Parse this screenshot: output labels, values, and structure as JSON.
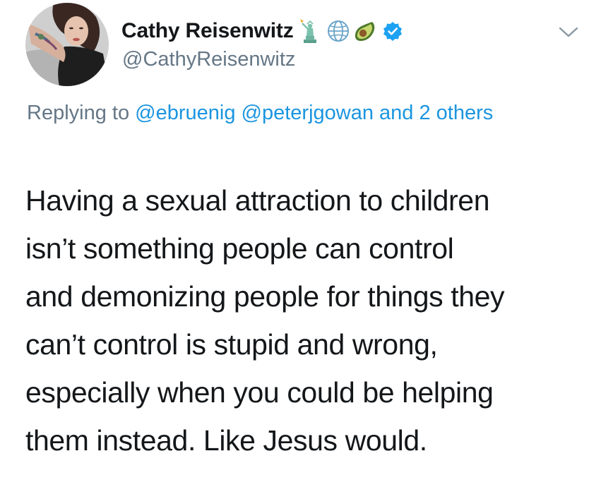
{
  "author": {
    "display_name": "Cathy Reisenwitz",
    "handle": "@CathyReisenwitz",
    "name_emojis": [
      "statue-of-liberty-icon",
      "globe-icon",
      "avocado-icon"
    ],
    "verified": true
  },
  "reply": {
    "prefix": "Replying to",
    "mention_1": "@ebruenig",
    "mention_2": "@peterjgowan",
    "others": "and 2 others"
  },
  "tweet": {
    "text_lines": [
      "Having a sexual attraction to children",
      "isn’t something people can control",
      "and demonizing people for things they",
      "can’t control is stupid and wrong,",
      "especially when you could be helping",
      "them instead. Like Jesus would."
    ]
  },
  "colors": {
    "text": "#14171a",
    "secondary": "#657786",
    "link": "#1b95e0",
    "verified": "#1da1f2"
  }
}
